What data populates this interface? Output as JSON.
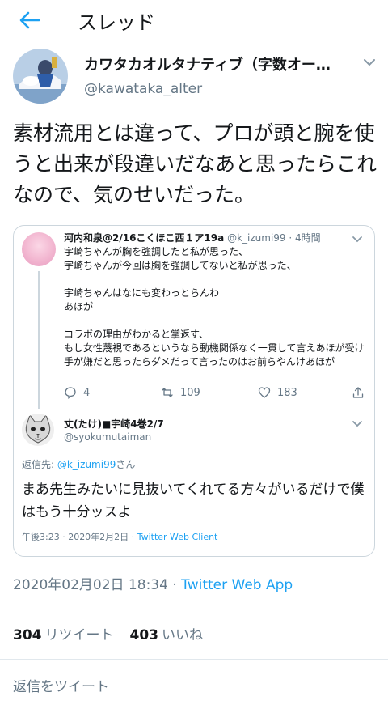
{
  "topbar": {
    "title": "スレッド"
  },
  "author": {
    "name": "カワタカオルタナティブ（字数オー…",
    "handle": "@kawataka_alter"
  },
  "tweet": {
    "text": "素材流用とは違って、プロが頭と腕を使うと出来が段違いだなあと思ったらこれなので、気のせいだった。"
  },
  "quote": {
    "name": "河内和泉@2/16こくほこ西１ア19a",
    "handle": "@k_izumi99",
    "time": "· 4時間",
    "body": "宇崎ちゃんが胸を強調したと私が思った、\n宇崎ちゃんが今回は胸を強調してないと私が思った、\n\n宇崎ちゃんはなにも変わっとらんわ\nあほが\n\nコラボの理由がわかると掌返す、\nもし女性蔑視であるというなら動機関係なく一貫して言えあほが受け手が嫌だと思ったらダメだって言ったのはお前らやんけあほが",
    "replies": "4",
    "retweets": "109",
    "likes": "183",
    "avatar_color": "#f2b6d0"
  },
  "reply": {
    "name": "丈(たけ)■宇崎4巻2/7",
    "handle": "@syokumutaiman",
    "reply_to_prefix": "返信先: ",
    "reply_to_link": "@k_izumi99",
    "reply_to_suffix": "さん",
    "text": "まあ先生みたいに見抜いてくれてる方々がいるだけで僕はもう十分ッスよ",
    "meta_time": "午後3:23 · 2020年2月2日 · ",
    "meta_client": "Twitter Web Client"
  },
  "timestamp": {
    "datetime": "2020年02月02日 18:34 · ",
    "client": "Twitter Web App"
  },
  "stats": {
    "retweets_count": "304",
    "retweets_label": "リツイート",
    "likes_count": "403",
    "likes_label": "いいね"
  },
  "compose": {
    "placeholder": "返信をツイート"
  },
  "colors": {
    "accent": "#1da1f2",
    "muted": "#657786",
    "border": "#e1e8ed"
  }
}
